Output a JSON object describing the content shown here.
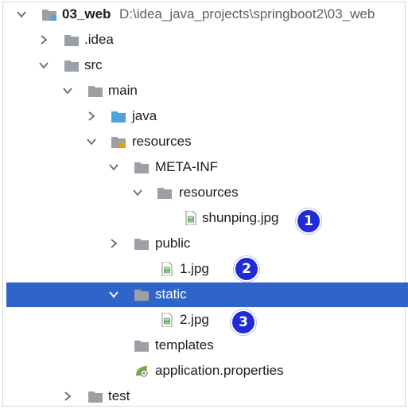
{
  "tree": {
    "root": {
      "label": "03_web",
      "path": "D:\\idea_java_projects\\springboot2\\03_web"
    },
    "idea": {
      "label": ".idea"
    },
    "src": {
      "label": "src"
    },
    "main": {
      "label": "main"
    },
    "java": {
      "label": "java"
    },
    "resources": {
      "label": "resources"
    },
    "meta_inf": {
      "label": "META-INF"
    },
    "meta_resources": {
      "label": "resources"
    },
    "shunping": {
      "label": "shunping.jpg"
    },
    "public": {
      "label": "public"
    },
    "one_jpg": {
      "label": "1.jpg"
    },
    "static": {
      "label": "static"
    },
    "two_jpg": {
      "label": "2.jpg"
    },
    "templates": {
      "label": "templates"
    },
    "app_props": {
      "label": "application.properties"
    },
    "test": {
      "label": "test"
    }
  },
  "badges": [
    "1",
    "2",
    "3"
  ],
  "colors": {
    "selection": "#2f65ca",
    "folder": "#9aa0a6",
    "source_folder": "#4fa3d9",
    "badge": "#1f2bd6"
  },
  "icons": {
    "expanded": "chevron-down-icon",
    "collapsed": "chevron-right-icon",
    "folder": "folder-icon",
    "module": "module-folder-icon",
    "source": "source-folder-icon",
    "resources": "resources-folder-icon",
    "image": "image-file-icon",
    "properties": "spring-properties-icon"
  }
}
